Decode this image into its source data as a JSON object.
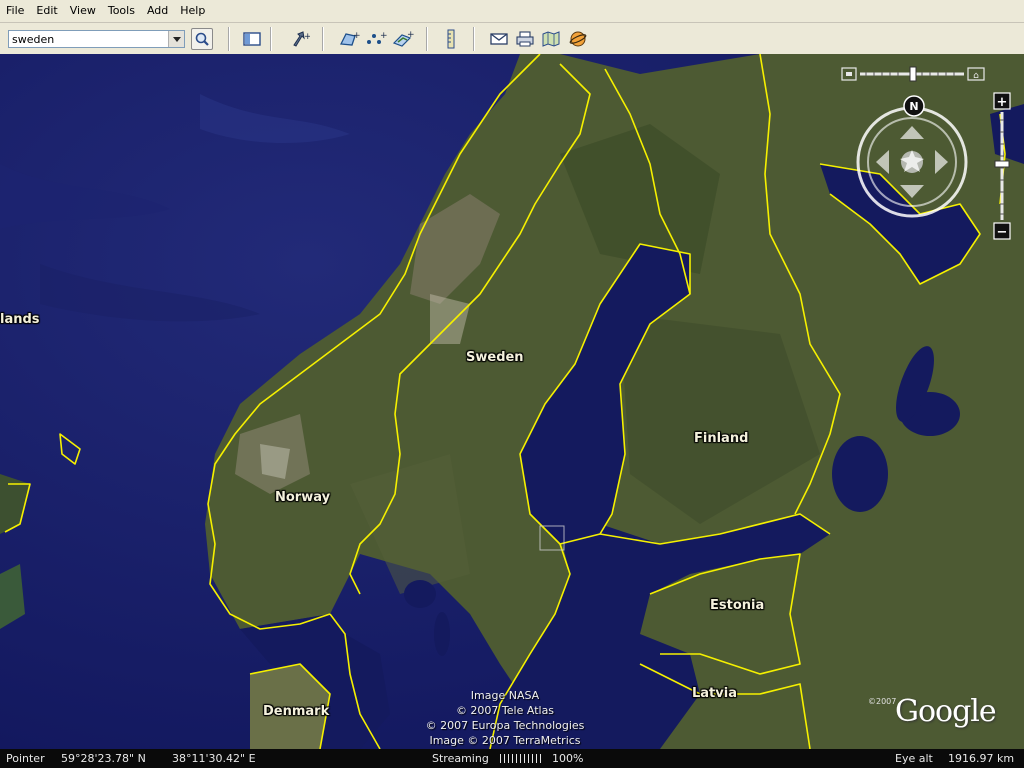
{
  "menu": [
    "File",
    "Edit",
    "View",
    "Tools",
    "Add",
    "Help"
  ],
  "search": {
    "value": "sweden"
  },
  "toolbar_icons": [
    "magnifier-icon",
    "sidebar-icon",
    "placemark-icon",
    "polygon-icon",
    "path-icon",
    "image-overlay-icon",
    "ruler-icon",
    "email-icon",
    "print-icon",
    "maps-icon",
    "sky-icon"
  ],
  "labels": {
    "sweden": "Sweden",
    "norway": "Norway",
    "finland": "Finland",
    "estonia": "Estonia",
    "latvia": "Latvia",
    "denmark": "Denmark",
    "islands": "lands"
  },
  "attribution": [
    "Image NASA",
    "© 2007 Tele Atlas",
    "© 2007 Europa Technologies",
    "Image © 2007 TerraMetrics"
  ],
  "brand": {
    "logo": "Google",
    "copyright": "©2007"
  },
  "navigation": {
    "north": "N",
    "zoom_in": "+",
    "zoom_out": "−"
  },
  "status": {
    "pointer_label": "Pointer",
    "latitude": "59°28'23.78\" N",
    "longitude": "38°11'30.42\" E",
    "streaming_label": "Streaming",
    "streaming_percent": "100%",
    "eye_alt_label": "Eye alt",
    "eye_alt": "1916.97 km"
  },
  "colors": {
    "border": "#f5f000",
    "sea": "#141a5e",
    "land": "#4e5a34"
  }
}
